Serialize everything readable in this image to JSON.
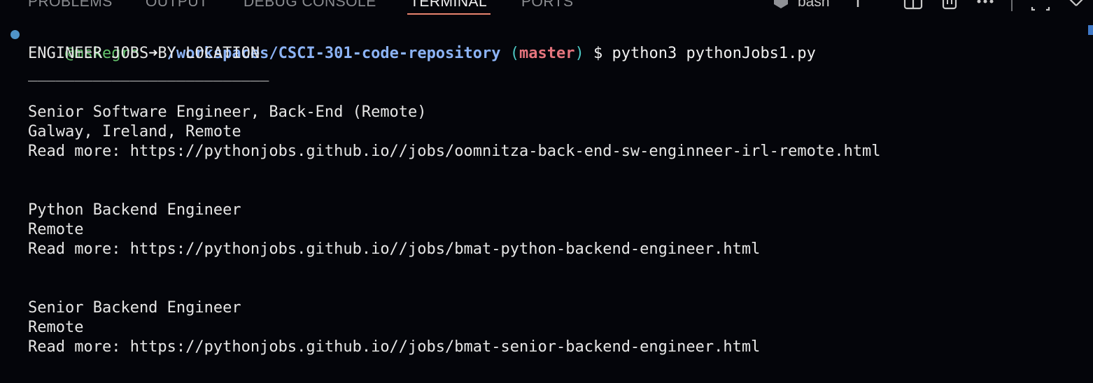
{
  "panel": {
    "tabs": [
      {
        "label": "PROBLEMS"
      },
      {
        "label": "OUTPUT"
      },
      {
        "label": "DEBUG CONSOLE"
      },
      {
        "label": "TERMINAL"
      },
      {
        "label": "PORTS"
      }
    ],
    "active_tab": "TERMINAL",
    "shell_label": "bash",
    "accent_color": "#e8836e"
  },
  "prompt": {
    "user": "@mskegro",
    "arrow": "➜",
    "path": "/workspaces/CSCI-301-code-repository",
    "paren_open": "(",
    "branch": "master",
    "paren_close": ")",
    "symbol": "$",
    "command": "python3 pythonJobs1.py"
  },
  "output": {
    "heading": "ENGINEER JOBS BY LOCATION",
    "separator": "__________________________",
    "jobs": [
      {
        "title": "Senior Software Engineer, Back-End (Remote)",
        "location": "Galway, Ireland, Remote",
        "read_more": "Read more: https://pythonjobs.github.io//jobs/oomnitza-back-end-sw-enginneer-irl-remote.html"
      },
      {
        "title": "Python Backend Engineer",
        "location": "Remote",
        "read_more": "Read more: https://pythonjobs.github.io//jobs/bmat-python-backend-engineer.html"
      },
      {
        "title": "Senior Backend Engineer",
        "location": "Remote",
        "read_more": "Read more: https://pythonjobs.github.io//jobs/bmat-senior-backend-engineer.html"
      }
    ]
  }
}
